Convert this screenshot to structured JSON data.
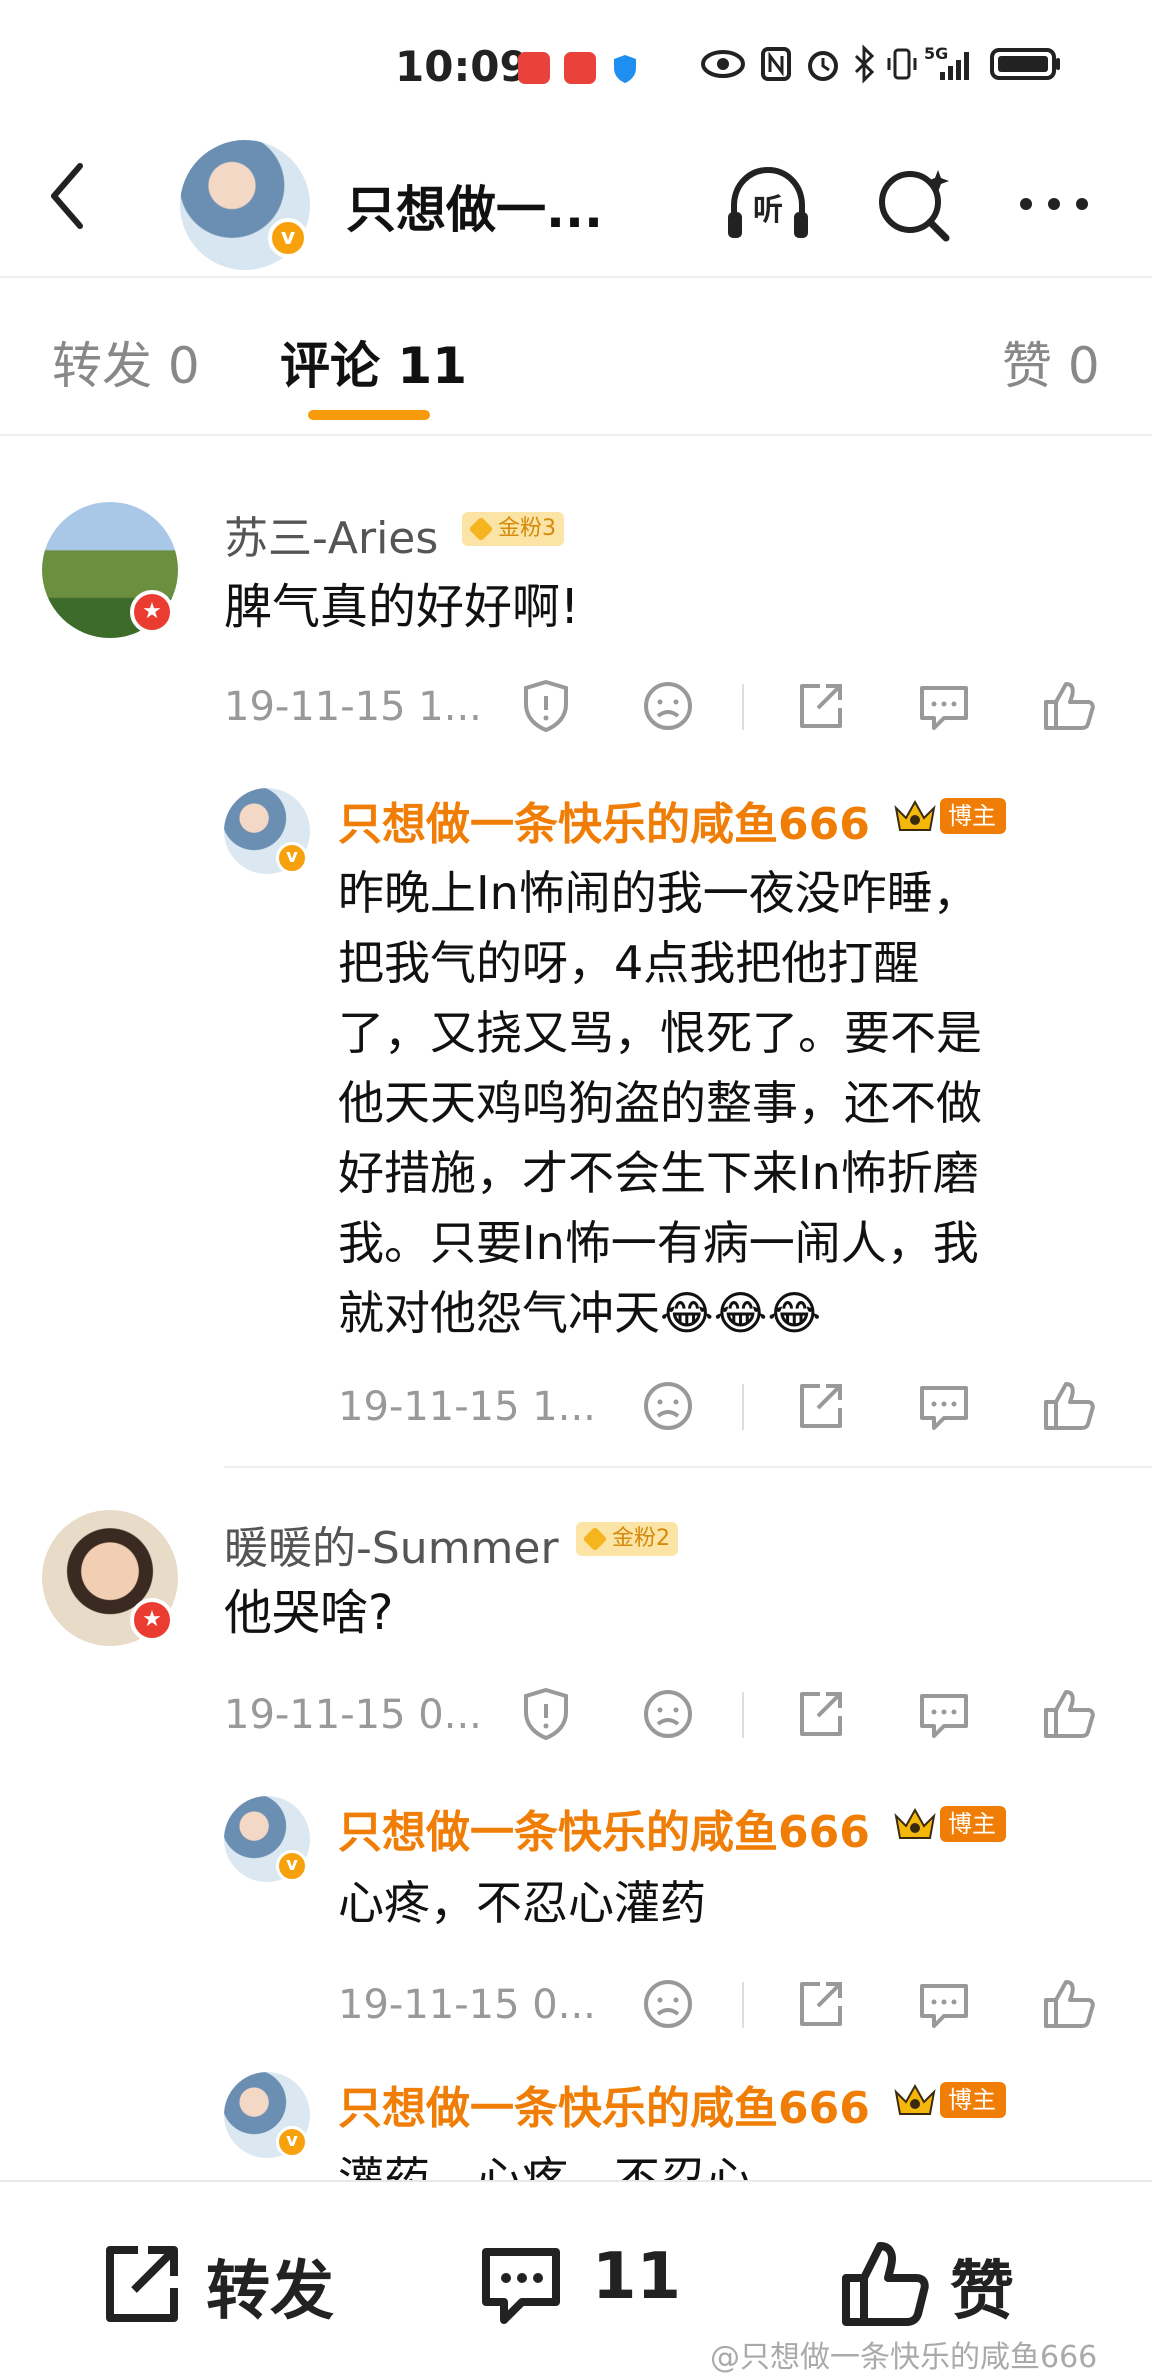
{
  "status_bar": {
    "time": "10:09",
    "network": "5G"
  },
  "header": {
    "title": "只想做一...",
    "listen_label": "听"
  },
  "tabs": [
    {
      "label": "转发 0"
    },
    {
      "label": "评论 11"
    },
    {
      "label": "赞 0"
    }
  ],
  "comments": [
    {
      "username": "苏三-Aries",
      "fan_badge": "金粉3",
      "text": "脾气真的好好啊!",
      "time": "19-11-15 1...",
      "reply": {
        "username": "只想做一条快乐的咸鱼666",
        "role_badge": "博主",
        "lines": [
          "昨晚上In怖闹的我一夜没咋睡，",
          "把我气的呀，4点我把他打醒",
          "了，又挠又骂，恨死了。要不是",
          "他天天鸡鸣狗盗的整事，还不做",
          "好措施，才不会生下来In怖折磨",
          "我。只要In怖一有病一闹人，我",
          "就对他怨气冲天😂😂😂"
        ],
        "time": "19-11-15 1..."
      }
    },
    {
      "username": "暖暖的-Summer",
      "fan_badge": "金粉2",
      "text": "他哭啥?",
      "time": "19-11-15 0...",
      "replies": [
        {
          "username": "只想做一条快乐的咸鱼666",
          "role_badge": "博主",
          "text": "心疼，不忍心灌药",
          "time": "19-11-15 0..."
        },
        {
          "username": "只想做一条快乐的咸鱼666",
          "role_badge": "博主",
          "text": "灌药，心疼，不忍心"
        }
      ]
    }
  ],
  "bottom_bar": {
    "repost_label": "转发",
    "comment_count": "11",
    "like_label": "赞"
  },
  "watermark": "@只想做一条快乐的咸鱼666",
  "colors": {
    "accent": "#f79b0c",
    "blogger": "#f07d05",
    "badge_red": "#ea3c31"
  }
}
